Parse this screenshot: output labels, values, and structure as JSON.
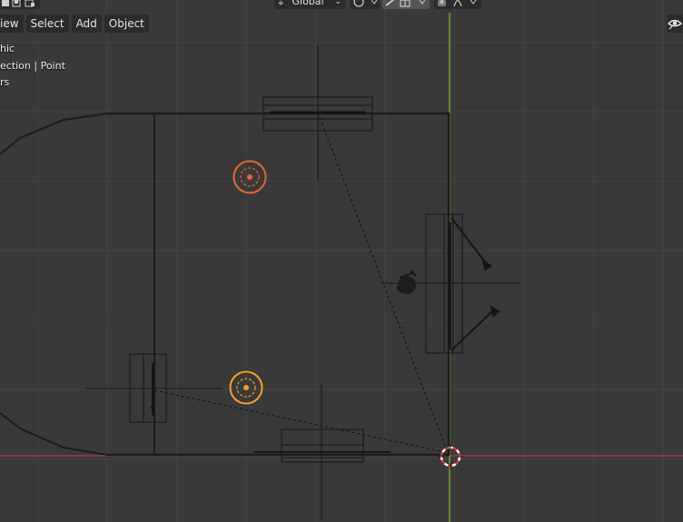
{
  "header": {
    "menu": [
      {
        "id": "view",
        "label": "iew"
      },
      {
        "id": "select",
        "label": "Select"
      },
      {
        "id": "add",
        "label": "Add"
      },
      {
        "id": "object",
        "label": "Object"
      }
    ],
    "transform_orientation": "Global",
    "icons": [
      "mode-icon",
      "global-axes-icon",
      "snap-icon",
      "proportional-edit-icon",
      "overlay-icon",
      "falloff-icon",
      "visibility-eye-icon"
    ]
  },
  "viewport_info": {
    "line1": "hic",
    "line2": "ection | Point",
    "line3": "rs"
  },
  "colors": {
    "background": "#393939",
    "grid": "#424242",
    "x_axis": "#b53a45",
    "y_axis": "#7ba732",
    "wire": "#111111",
    "light_selected": "#e2662f",
    "light_active": "#f2a02a",
    "cursor": "#ffffff"
  }
}
